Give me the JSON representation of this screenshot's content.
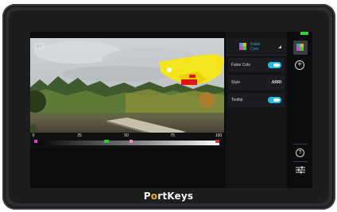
{
  "brand": {
    "logo_prefix": "P",
    "logo_o": "o",
    "logo_suffix": "rtKeys"
  },
  "panel": {
    "header_title": "False Colo",
    "rows": [
      {
        "label": "False Colo",
        "toggle": true
      },
      {
        "label": "Style",
        "value": "ARRI"
      },
      {
        "label": "Tooltip",
        "toggle": true
      }
    ]
  },
  "scale": {
    "ticks": [
      "0",
      "25",
      "50",
      "75",
      "100"
    ]
  },
  "icons": {
    "viewport": "frame-guide-icon",
    "header": "false-color-icon",
    "rail": [
      "battery-icon",
      "false-color-icon",
      "add-icon",
      "help-icon",
      "settings-icon"
    ]
  },
  "colors": {
    "accent": "#27b6e6",
    "header_title": "#2ea7dc",
    "battery": "#35d23e",
    "logo_accent": "#e8b21c"
  }
}
